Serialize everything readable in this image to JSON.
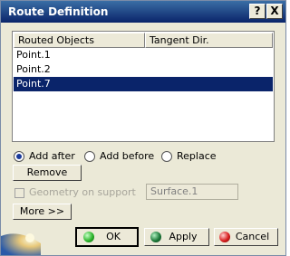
{
  "window": {
    "title": "Route Definition",
    "help_label": "?",
    "close_label": "X"
  },
  "list": {
    "columns": [
      "Routed Objects",
      "Tangent Dir."
    ],
    "rows": [
      "Point.1",
      "Point.2",
      "Point.7"
    ],
    "selected_index": 2
  },
  "options": {
    "add_after": "Add after",
    "add_before": "Add before",
    "replace": "Replace",
    "selected": "add_after"
  },
  "buttons": {
    "remove": "Remove",
    "more": "More >>",
    "ok": "OK",
    "apply": "Apply",
    "cancel": "Cancel"
  },
  "geometry": {
    "label": "Geometry on support",
    "support_value": "Surface.1",
    "checked": false
  },
  "colors": {
    "selection": "#0a246a",
    "ok_ball": "#2db52d",
    "apply_ball": "#1e7a3a",
    "cancel_ball": "#d81e1e"
  }
}
